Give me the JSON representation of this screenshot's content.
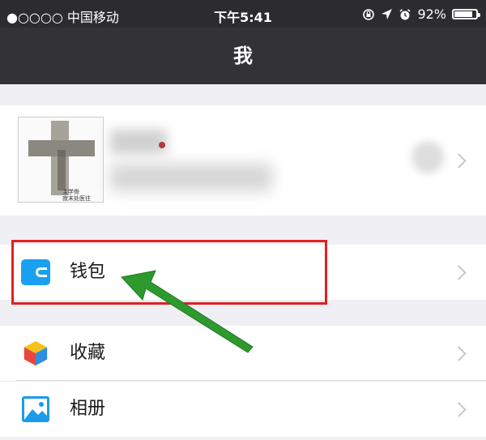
{
  "status_bar": {
    "carrier": "●○○○○ 中国移动",
    "time": "下午5:41",
    "battery_percent": "92%",
    "battery_level": 0.92,
    "icons": [
      "orientation-lock-icon",
      "location-arrow-icon",
      "alarm-icon",
      "battery-icon"
    ]
  },
  "nav": {
    "title": "我"
  },
  "profile": {
    "avatar_caption_line1": "主学骨",
    "avatar_caption_line2": "寂末处医往"
  },
  "menu": {
    "wallet": {
      "label": "钱包",
      "icon": "wallet-icon"
    },
    "favorites": {
      "label": "收藏",
      "icon": "cube-icon"
    },
    "album": {
      "label": "相册",
      "icon": "photo-icon"
    }
  },
  "annotation": {
    "highlight_color": "#e02020",
    "arrow_color": "#2e9a2e"
  },
  "colors": {
    "wallet_blue": "#1aa0f0",
    "nav_bg": "#333336"
  }
}
